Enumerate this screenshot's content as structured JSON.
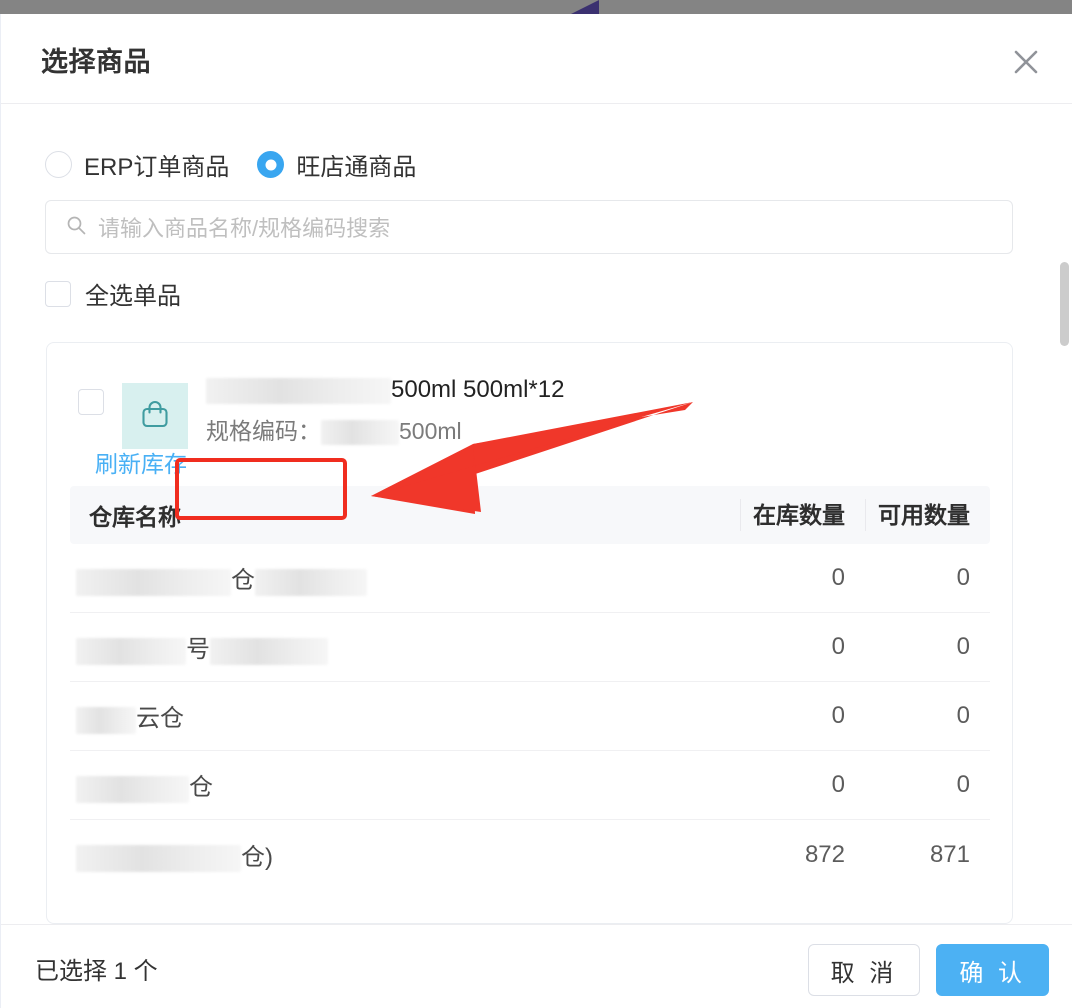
{
  "window": {
    "backdrop_color": "#848484",
    "accent_color": "#3b3170"
  },
  "modal": {
    "title": "选择商品",
    "close_icon": "close-icon"
  },
  "source_options": {
    "items": [
      {
        "label": "ERP订单商品",
        "selected": false
      },
      {
        "label": "旺店通商品",
        "selected": true
      }
    ],
    "selected_color": "#39a6f0"
  },
  "search": {
    "icon": "search-icon",
    "placeholder": "请输入商品名称/规格编码搜索",
    "value": ""
  },
  "select_all": {
    "label": "全选单品",
    "checked": false
  },
  "product": {
    "checked": false,
    "thumb_icon": "shopping-bag-icon",
    "name_redacted_prefix": "",
    "name_suffix": "500ml 500ml*12",
    "spec_label": "规格编码：",
    "spec_suffix": "500ml",
    "refresh_link": "刷新库存",
    "refresh_link_color": "#49b0f5"
  },
  "warehouse_table": {
    "columns": [
      "仓库名称",
      "在库数量",
      "可用数量"
    ],
    "rows": [
      {
        "name_fragment": "仓",
        "in_stock": "0",
        "available": "0"
      },
      {
        "name_fragment": "号",
        "in_stock": "0",
        "available": "0"
      },
      {
        "name_fragment": "云仓",
        "in_stock": "0",
        "available": "0"
      },
      {
        "name_fragment": "仓",
        "in_stock": "0",
        "available": "0"
      },
      {
        "name_fragment": "仓)",
        "in_stock": "872",
        "available": "871"
      }
    ]
  },
  "footer": {
    "selected_text": "已选择 1 个",
    "cancel_label": "取 消",
    "confirm_label": "确 认",
    "confirm_color": "#4cb1f3"
  },
  "annotation": {
    "color": "#f02d1f",
    "target": "刷新库存"
  }
}
